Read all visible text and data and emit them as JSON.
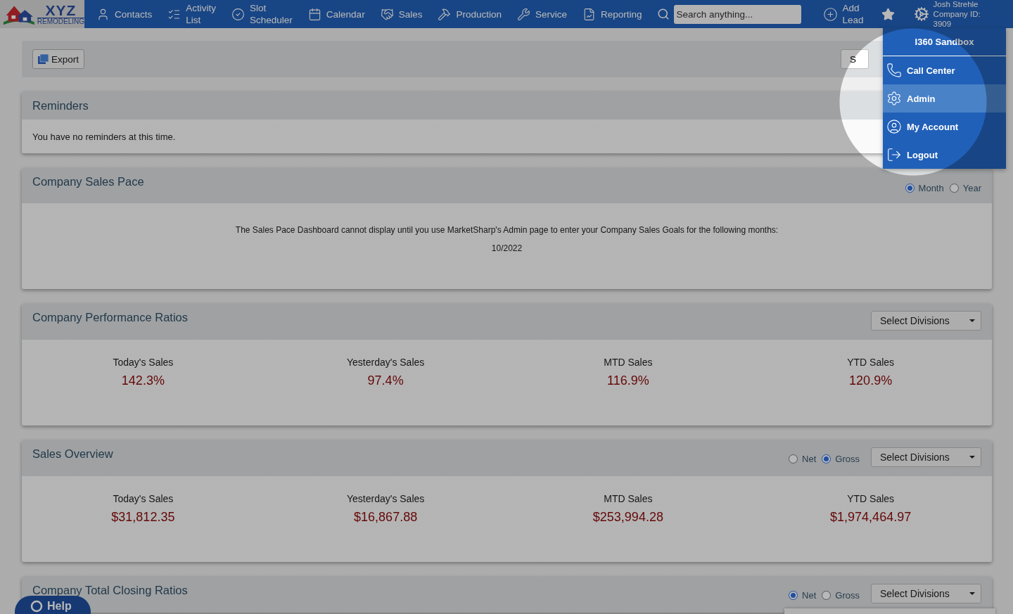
{
  "navbar": {
    "logo": {
      "top": "XYZ",
      "bottom": "REMODELING"
    },
    "items": [
      {
        "label": "Contacts"
      },
      {
        "label": "Activity List"
      },
      {
        "label": "Slot Scheduler"
      },
      {
        "label": "Calendar"
      },
      {
        "label": "Sales"
      },
      {
        "label": "Production"
      },
      {
        "label": "Service"
      },
      {
        "label": "Reporting"
      }
    ],
    "search": {
      "placeholder": "Search anything..."
    },
    "add_lead": "Add Lead",
    "user": {
      "name": "Josh Strehle",
      "company": "Company ID:",
      "company_id": "3909"
    }
  },
  "toolbar": {
    "export": "Export",
    "field": "S"
  },
  "reminders": {
    "title": "Reminders",
    "message": "You have no reminders at this time."
  },
  "sales_pace": {
    "title": "Company Sales Pace",
    "options": [
      {
        "label": "Month",
        "selected": true
      },
      {
        "label": "Year",
        "selected": false
      }
    ],
    "message": "The Sales Pace Dashboard cannot display until you use MarketSharp's Admin page to enter your Company Sales Goals for the following months:",
    "months": "10/2022"
  },
  "performance_ratios": {
    "title": "Company Performance Ratios",
    "select": "Select Divisions",
    "metrics": [
      {
        "label": "Today's Sales",
        "value": "142.3%"
      },
      {
        "label": "Yesterday's Sales",
        "value": "97.4%"
      },
      {
        "label": "MTD Sales",
        "value": "116.9%"
      },
      {
        "label": "YTD Sales",
        "value": "120.9%"
      }
    ]
  },
  "sales_overview": {
    "title": "Sales Overview",
    "options": [
      {
        "label": "Net",
        "selected": false
      },
      {
        "label": "Gross",
        "selected": true
      }
    ],
    "select": "Select Divisions",
    "metrics": [
      {
        "label": "Today's Sales",
        "value": "$31,812.35"
      },
      {
        "label": "Yesterday's Sales",
        "value": "$16,867.88"
      },
      {
        "label": "MTD Sales",
        "value": "$253,994.28"
      },
      {
        "label": "YTD Sales",
        "value": "$1,974,464.97"
      }
    ]
  },
  "closing_ratios": {
    "title": "Company Total Closing Ratios",
    "options": [
      {
        "label": "Net",
        "selected": true
      },
      {
        "label": "Gross",
        "selected": false
      }
    ],
    "select": "Select Divisions"
  },
  "user_menu": {
    "title": "I360 Sandbox",
    "items": [
      {
        "label": "Call Center",
        "selected": false
      },
      {
        "label": "Admin",
        "selected": true
      },
      {
        "label": "My Account",
        "selected": false
      },
      {
        "label": "Logout",
        "selected": false
      }
    ]
  },
  "help": "Help"
}
